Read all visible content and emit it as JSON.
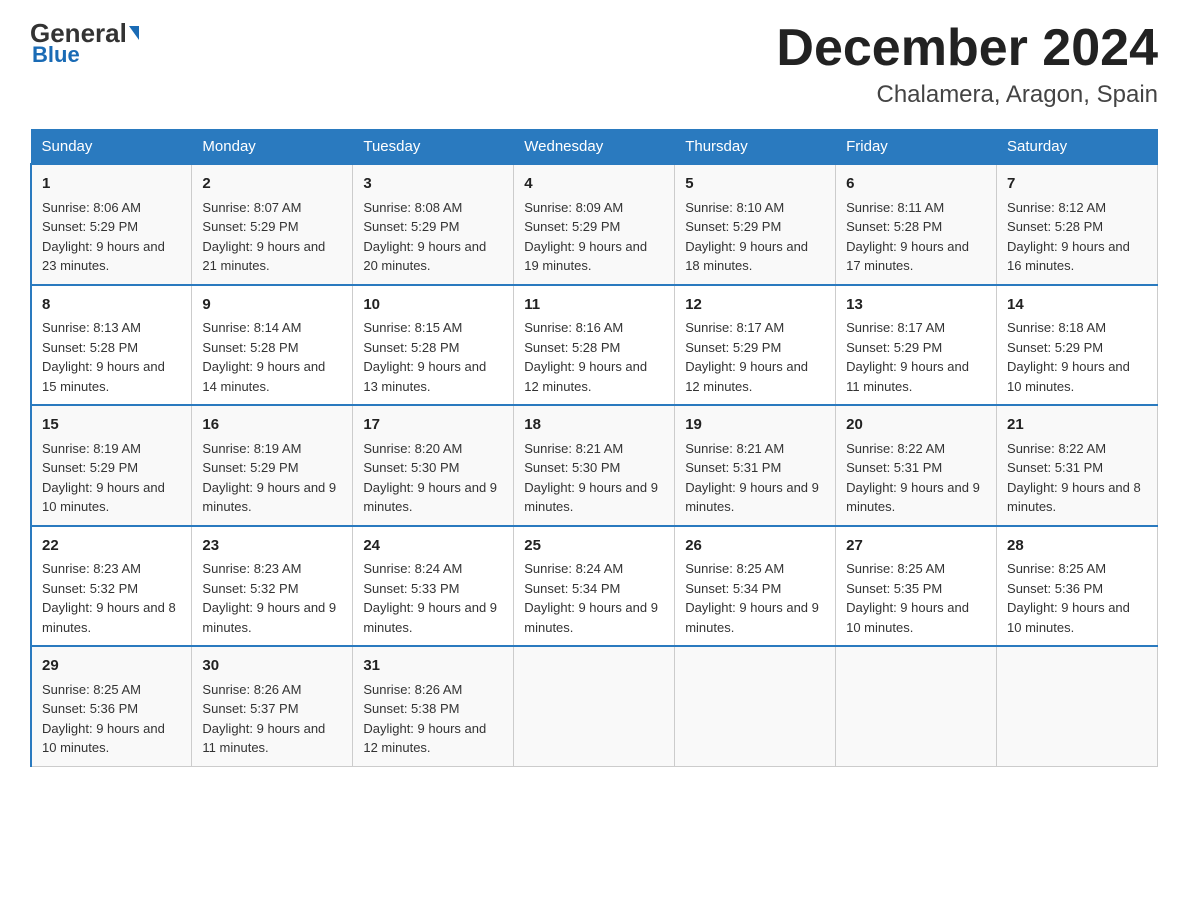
{
  "logo": {
    "text": "General",
    "blue": "Blue"
  },
  "title": "December 2024",
  "subtitle": "Chalamera, Aragon, Spain",
  "days_header": [
    "Sunday",
    "Monday",
    "Tuesday",
    "Wednesday",
    "Thursday",
    "Friday",
    "Saturday"
  ],
  "weeks": [
    [
      {
        "num": "1",
        "sunrise": "8:06 AM",
        "sunset": "5:29 PM",
        "daylight": "9 hours and 23 minutes."
      },
      {
        "num": "2",
        "sunrise": "8:07 AM",
        "sunset": "5:29 PM",
        "daylight": "9 hours and 21 minutes."
      },
      {
        "num": "3",
        "sunrise": "8:08 AM",
        "sunset": "5:29 PM",
        "daylight": "9 hours and 20 minutes."
      },
      {
        "num": "4",
        "sunrise": "8:09 AM",
        "sunset": "5:29 PM",
        "daylight": "9 hours and 19 minutes."
      },
      {
        "num": "5",
        "sunrise": "8:10 AM",
        "sunset": "5:29 PM",
        "daylight": "9 hours and 18 minutes."
      },
      {
        "num": "6",
        "sunrise": "8:11 AM",
        "sunset": "5:28 PM",
        "daylight": "9 hours and 17 minutes."
      },
      {
        "num": "7",
        "sunrise": "8:12 AM",
        "sunset": "5:28 PM",
        "daylight": "9 hours and 16 minutes."
      }
    ],
    [
      {
        "num": "8",
        "sunrise": "8:13 AM",
        "sunset": "5:28 PM",
        "daylight": "9 hours and 15 minutes."
      },
      {
        "num": "9",
        "sunrise": "8:14 AM",
        "sunset": "5:28 PM",
        "daylight": "9 hours and 14 minutes."
      },
      {
        "num": "10",
        "sunrise": "8:15 AM",
        "sunset": "5:28 PM",
        "daylight": "9 hours and 13 minutes."
      },
      {
        "num": "11",
        "sunrise": "8:16 AM",
        "sunset": "5:28 PM",
        "daylight": "9 hours and 12 minutes."
      },
      {
        "num": "12",
        "sunrise": "8:17 AM",
        "sunset": "5:29 PM",
        "daylight": "9 hours and 12 minutes."
      },
      {
        "num": "13",
        "sunrise": "8:17 AM",
        "sunset": "5:29 PM",
        "daylight": "9 hours and 11 minutes."
      },
      {
        "num": "14",
        "sunrise": "8:18 AM",
        "sunset": "5:29 PM",
        "daylight": "9 hours and 10 minutes."
      }
    ],
    [
      {
        "num": "15",
        "sunrise": "8:19 AM",
        "sunset": "5:29 PM",
        "daylight": "9 hours and 10 minutes."
      },
      {
        "num": "16",
        "sunrise": "8:19 AM",
        "sunset": "5:29 PM",
        "daylight": "9 hours and 9 minutes."
      },
      {
        "num": "17",
        "sunrise": "8:20 AM",
        "sunset": "5:30 PM",
        "daylight": "9 hours and 9 minutes."
      },
      {
        "num": "18",
        "sunrise": "8:21 AM",
        "sunset": "5:30 PM",
        "daylight": "9 hours and 9 minutes."
      },
      {
        "num": "19",
        "sunrise": "8:21 AM",
        "sunset": "5:31 PM",
        "daylight": "9 hours and 9 minutes."
      },
      {
        "num": "20",
        "sunrise": "8:22 AM",
        "sunset": "5:31 PM",
        "daylight": "9 hours and 9 minutes."
      },
      {
        "num": "21",
        "sunrise": "8:22 AM",
        "sunset": "5:31 PM",
        "daylight": "9 hours and 8 minutes."
      }
    ],
    [
      {
        "num": "22",
        "sunrise": "8:23 AM",
        "sunset": "5:32 PM",
        "daylight": "9 hours and 8 minutes."
      },
      {
        "num": "23",
        "sunrise": "8:23 AM",
        "sunset": "5:32 PM",
        "daylight": "9 hours and 9 minutes."
      },
      {
        "num": "24",
        "sunrise": "8:24 AM",
        "sunset": "5:33 PM",
        "daylight": "9 hours and 9 minutes."
      },
      {
        "num": "25",
        "sunrise": "8:24 AM",
        "sunset": "5:34 PM",
        "daylight": "9 hours and 9 minutes."
      },
      {
        "num": "26",
        "sunrise": "8:25 AM",
        "sunset": "5:34 PM",
        "daylight": "9 hours and 9 minutes."
      },
      {
        "num": "27",
        "sunrise": "8:25 AM",
        "sunset": "5:35 PM",
        "daylight": "9 hours and 10 minutes."
      },
      {
        "num": "28",
        "sunrise": "8:25 AM",
        "sunset": "5:36 PM",
        "daylight": "9 hours and 10 minutes."
      }
    ],
    [
      {
        "num": "29",
        "sunrise": "8:25 AM",
        "sunset": "5:36 PM",
        "daylight": "9 hours and 10 minutes."
      },
      {
        "num": "30",
        "sunrise": "8:26 AM",
        "sunset": "5:37 PM",
        "daylight": "9 hours and 11 minutes."
      },
      {
        "num": "31",
        "sunrise": "8:26 AM",
        "sunset": "5:38 PM",
        "daylight": "9 hours and 12 minutes."
      },
      null,
      null,
      null,
      null
    ]
  ],
  "labels": {
    "sunrise": "Sunrise:",
    "sunset": "Sunset:",
    "daylight": "Daylight:"
  }
}
